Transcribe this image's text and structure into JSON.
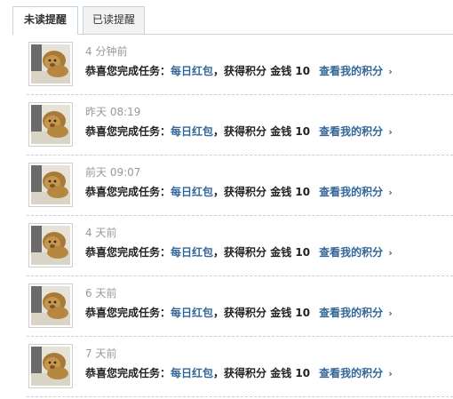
{
  "tabs": [
    {
      "label": "未读提醒",
      "active": true
    },
    {
      "label": "已读提醒",
      "active": false
    }
  ],
  "notifications": [
    {
      "time": "4 分钟前",
      "prefix": "恭喜您完成任务：",
      "task": "每日红包",
      "reward": "，获得积分 金钱 10",
      "link": "查看我的积分",
      "chevron": "›"
    },
    {
      "time": "昨天 08:19",
      "prefix": "恭喜您完成任务：",
      "task": "每日红包",
      "reward": "，获得积分 金钱 10",
      "link": "查看我的积分",
      "chevron": "›"
    },
    {
      "time": "前天 09:07",
      "prefix": "恭喜您完成任务：",
      "task": "每日红包",
      "reward": "，获得积分 金钱 10",
      "link": "查看我的积分",
      "chevron": "›"
    },
    {
      "time": "4 天前",
      "prefix": "恭喜您完成任务：",
      "task": "每日红包",
      "reward": "，获得积分 金钱 10",
      "link": "查看我的积分",
      "chevron": "›"
    },
    {
      "time": "6 天前",
      "prefix": "恭喜您完成任务：",
      "task": "每日红包",
      "reward": "，获得积分 金钱 10",
      "link": "查看我的积分",
      "chevron": "›"
    },
    {
      "time": "7 天前",
      "prefix": "恭喜您完成任务：",
      "task": "每日红包",
      "reward": "，获得积分 金钱 10",
      "link": "查看我的积分",
      "chevron": "›"
    }
  ],
  "colors": {
    "link": "#336699",
    "time": "#999999",
    "border": "#c2d5e3"
  }
}
